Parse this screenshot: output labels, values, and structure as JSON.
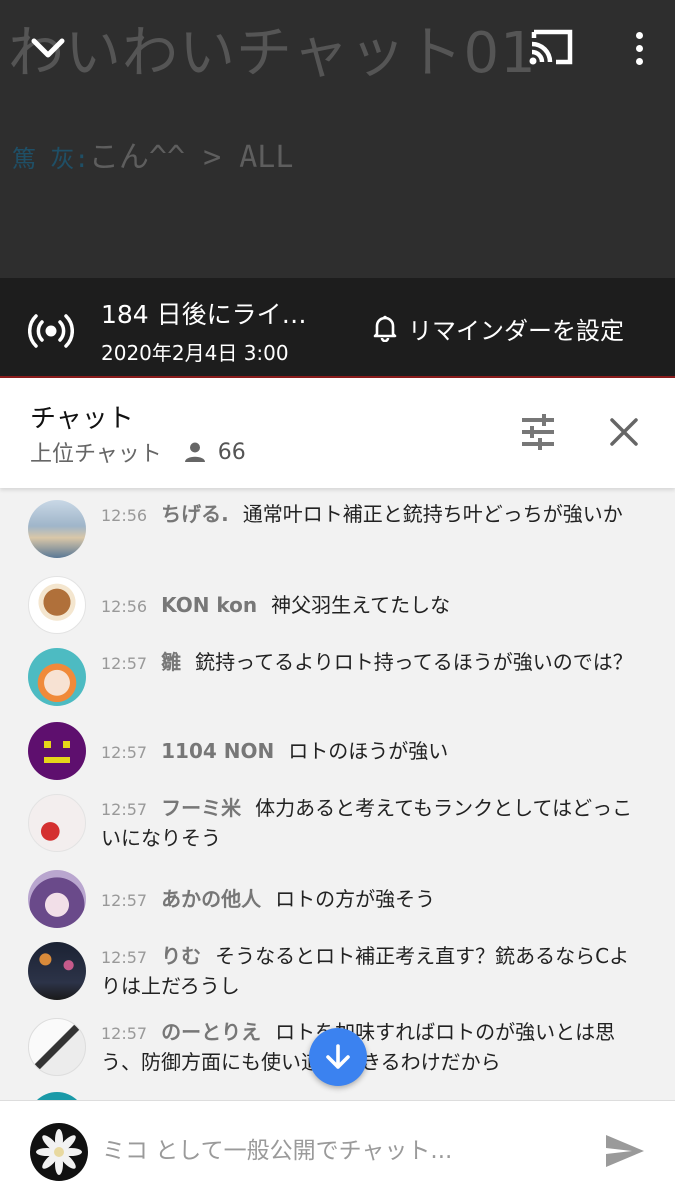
{
  "video": {
    "overlay_title": "わいわいチャット01",
    "overlay_sub_name": "篤 灰:",
    "overlay_sub_text": "こん^^ > ALL"
  },
  "live": {
    "title": "184 日後にライ…",
    "date": "2020年2月4日 3:00",
    "reminder_label": "リマインダーを設定"
  },
  "chat_header": {
    "title": "チャット",
    "mode": "上位チャット",
    "viewer_count": "66"
  },
  "messages": [
    {
      "time": "12:56",
      "author": "ちげる.",
      "text": "通常叶ロト補正と銃持ち叶どっちが強いか"
    },
    {
      "time": "12:56",
      "author": "KON kon",
      "text": "神父羽生えてたしな"
    },
    {
      "time": "12:57",
      "author": "雛",
      "text": "銃持ってるよりロト持ってるほうが強いのでは？"
    },
    {
      "time": "12:57",
      "author": "1104 NON",
      "text": "ロトのほうが強い"
    },
    {
      "time": "12:57",
      "author": "フーミ米",
      "text": "体力あると考えてもランクとしてはどっこいになりそう"
    },
    {
      "time": "12:57",
      "author": "あかの他人",
      "text": "ロトの方が強そう"
    },
    {
      "time": "12:57",
      "author": "りむ",
      "text": "そうなるとロト補正考え直す？銃あるならCよりは上だろうし"
    },
    {
      "time": "12:57",
      "author": "のーとりえ",
      "text": "ロトを加味すればロトのが強いとは思う、防御方面にも使い道ができるわけだから"
    }
  ],
  "input": {
    "placeholder": "ミコ として一般公開でチャット..."
  },
  "colors": {
    "accent_blue": "#3b82f0",
    "live_bar": "#1d1d1d",
    "video_bg": "#2e2e2e"
  }
}
